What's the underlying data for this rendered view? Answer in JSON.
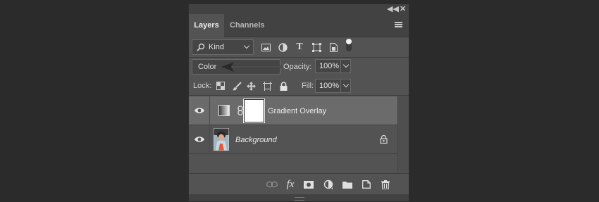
{
  "panel": {
    "collapse_icon": "double-chevron-left-icon",
    "close_icon": "close-icon",
    "tabs": [
      {
        "label": "Layers",
        "active": true
      },
      {
        "label": "Channels",
        "active": false
      }
    ],
    "menu_icon": "panel-menu-icon"
  },
  "filter": {
    "kind_label": "Kind",
    "icons": [
      "pixel-layer-filter-icon",
      "adjustment-layer-filter-icon",
      "type-layer-filter-icon",
      "shape-layer-filter-icon",
      "smart-object-filter-icon",
      "filter-toggle-icon"
    ]
  },
  "blend": {
    "mode": "Color",
    "opacity_label": "Opacity:",
    "opacity_value": "100%"
  },
  "lock": {
    "label": "Lock:",
    "icons": [
      "lock-transparent-pixels-icon",
      "lock-image-pixels-icon",
      "lock-position-icon",
      "lock-artboard-icon",
      "lock-all-icon"
    ],
    "fill_label": "Fill:",
    "fill_value": "100%"
  },
  "layers": [
    {
      "name": "Gradient Overlay",
      "selected": true,
      "visible": true,
      "type": "adjustment-with-mask"
    },
    {
      "name": "Background",
      "selected": false,
      "visible": true,
      "locked": true,
      "type": "image"
    }
  ],
  "footer": {
    "icons": [
      "link-layers-icon",
      "fx-icon",
      "add-mask-icon",
      "new-adjustment-layer-icon",
      "new-group-icon",
      "new-layer-icon",
      "delete-layer-icon"
    ],
    "fx_label": "fx"
  },
  "colors": {
    "panel_bg": "#535353",
    "selected_row": "#6b6b6b",
    "canvas_bg": "#2b2b2b"
  }
}
